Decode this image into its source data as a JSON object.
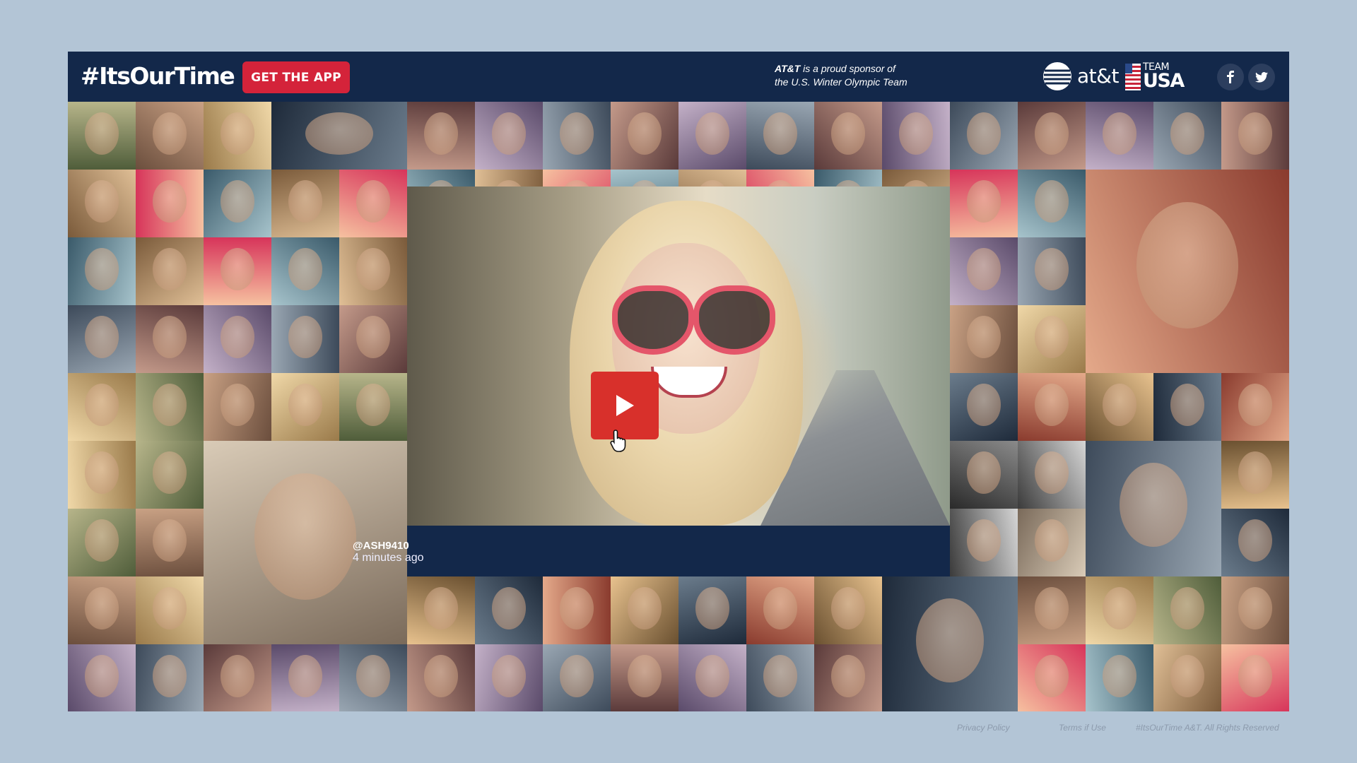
{
  "header": {
    "hashtag": "#ItsOurTime",
    "app_button": "GET THE APP",
    "sponsor_brand": "AT&T",
    "sponsor_rest_line1": " is a proud sponsor of",
    "sponsor_line2": "the U.S. Winter Olympic Team",
    "att_logo_text": "at&t",
    "team_usa_top": "TEAM",
    "team_usa_bottom": "USA",
    "social": [
      {
        "name": "facebook-icon",
        "glyph": "f"
      },
      {
        "name": "twitter-icon",
        "glyph": "t"
      }
    ]
  },
  "featured_video": {
    "handle": "@ASH9410",
    "time_ago": "4 minutes ago"
  },
  "footer": {
    "privacy": "Privacy Policy",
    "terms": "Terms if Use",
    "rights": "#ItsOurTime A&T. All Rights Reserved"
  },
  "colors": {
    "page_bg": "#b3c5d6",
    "header_bg": "#13284a",
    "accent_red": "#d4233a",
    "play_red": "#d8302b"
  }
}
